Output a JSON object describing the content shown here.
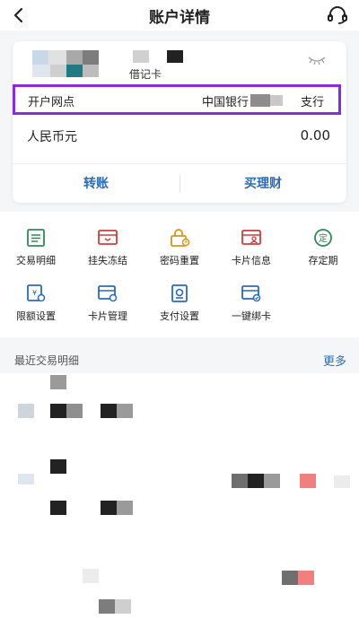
{
  "header": {
    "title": "账户详情",
    "back_icon": "chevron-left-icon",
    "support_icon": "headset-icon"
  },
  "account_card": {
    "card_type": "借记卡",
    "branch_label": "开户网点",
    "branch_name_prefix": "中国银行",
    "branch_name_suffix": "支行",
    "currency": "人民币元",
    "balance": "0.00",
    "actions": {
      "transfer": "转账",
      "wealth": "买理财"
    },
    "highlight_color": "#8a2be2"
  },
  "services": [
    {
      "label": "交易明细",
      "icon": "list-icon"
    },
    {
      "label": "挂失冻结",
      "icon": "card-lock-icon"
    },
    {
      "label": "密码重置",
      "icon": "password-reset-icon"
    },
    {
      "label": "卡片信息",
      "icon": "card-user-icon"
    },
    {
      "label": "存定期",
      "icon": "fixed-deposit-icon"
    },
    {
      "label": "限额设置",
      "icon": "limit-settings-icon"
    },
    {
      "label": "卡片管理",
      "icon": "card-manage-icon"
    },
    {
      "label": "支付设置",
      "icon": "payment-settings-icon"
    },
    {
      "label": "一键绑卡",
      "icon": "bind-card-icon"
    }
  ],
  "recent": {
    "title": "最近交易明细",
    "more": "更多"
  },
  "colors": {
    "accent_blue": "#2b6bb5",
    "icon_green": "#2e8b57",
    "icon_red": "#d23c3c",
    "icon_orange": "#d9941a",
    "icon_blue": "#2b6bb5"
  }
}
